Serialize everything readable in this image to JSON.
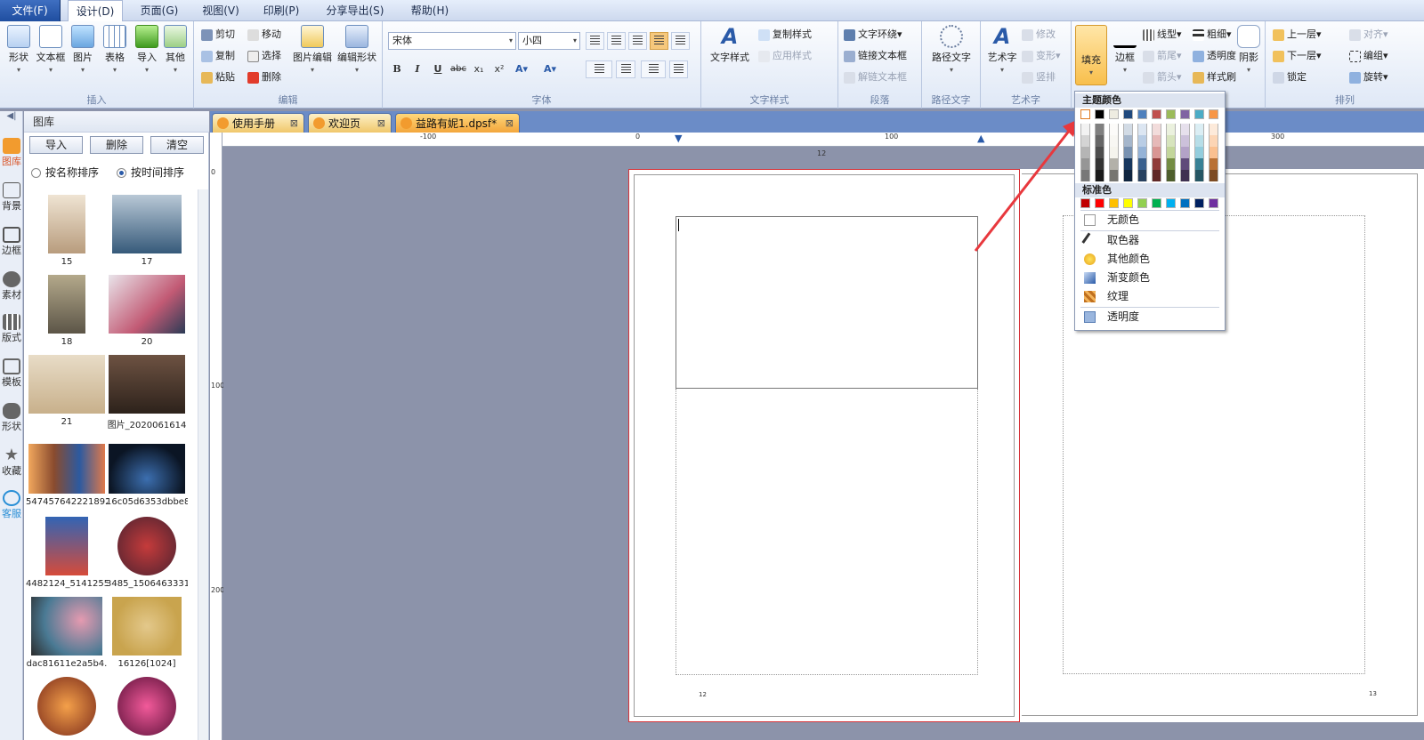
{
  "menubar": {
    "items": [
      "文件(F)",
      "设计(D)",
      "页面(G)",
      "视图(V)",
      "印刷(P)",
      "分享导出(S)",
      "帮助(H)"
    ]
  },
  "ribbon": {
    "insert": {
      "label": "插入",
      "buttons": [
        "形状",
        "文本框",
        "图片",
        "表格",
        "导入",
        "其他"
      ]
    },
    "edit": {
      "label": "编辑",
      "small": [
        "剪切",
        "复制",
        "粘贴",
        "移动",
        "选择",
        "删除"
      ],
      "big": [
        "图片编辑",
        "编辑形状"
      ]
    },
    "font": {
      "label": "字体",
      "font_name": "宋体",
      "font_size": "小四"
    },
    "text_style": {
      "label": "文字样式",
      "big": "文字样式",
      "small": [
        "复制样式",
        "应用样式"
      ]
    },
    "paragraph": {
      "label": "段落",
      "small": [
        "文字环绕",
        "链接文本框",
        "解链文本框"
      ]
    },
    "path_text": {
      "label": "路径文字",
      "big": "路径文字"
    },
    "art_text": {
      "label": "艺术字",
      "big": "艺术字",
      "small": [
        "修改",
        "变形",
        "竖排"
      ]
    },
    "shape_style": {
      "fill": "填充",
      "border": "边框",
      "small": [
        "线型",
        "箭尾",
        "箭头",
        "粗细",
        "透明度",
        "样式刷"
      ],
      "shadow": "阴影"
    },
    "arrange": {
      "label": "排列",
      "small": [
        "上一层",
        "下一层",
        "锁定",
        "对齐",
        "编组",
        "旋转"
      ]
    }
  },
  "gallery": {
    "title": "图库",
    "buttons": [
      "导入",
      "删除",
      "清空"
    ],
    "sort_options": [
      "按名称排序",
      "按时间排序"
    ],
    "sort_selected": "按时间排序",
    "items": [
      "15",
      "17",
      "18",
      "20",
      "21",
      "图片_2020061614",
      "547457642221892",
      "16c05d6353dbbe8",
      "4482124_5141255",
      "3485_1506463331",
      "dac81611e2a5b4.",
      "16126[1024]",
      "",
      ""
    ]
  },
  "side_strip": [
    "图库",
    "背景",
    "边框",
    "素材",
    "版式",
    "模板",
    "形状",
    "收藏",
    "客服"
  ],
  "tabs": [
    {
      "label": "使用手册",
      "active": false
    },
    {
      "label": "欢迎页",
      "active": false
    },
    {
      "label": "益路有妮1.dpsf*",
      "active": true
    }
  ],
  "ruler": {
    "h": [
      "-100",
      "0",
      "100",
      "200",
      "300"
    ],
    "v": [
      "0",
      "100",
      "200"
    ],
    "page_marker": "12"
  },
  "pages": {
    "left_number": "12",
    "right_number": "13"
  },
  "fill_menu": {
    "theme_header": "主题颜色",
    "standard_header": "标准色",
    "theme_top": [
      "#ffffff",
      "#000000",
      "#eeece1",
      "#1f497d",
      "#4f81bd",
      "#c0504d",
      "#9bbb59",
      "#8064a2",
      "#4bacc6",
      "#f79646"
    ],
    "standard": [
      "#c00000",
      "#ff0000",
      "#ffc000",
      "#ffff00",
      "#92d050",
      "#00b050",
      "#00b0f0",
      "#0070c0",
      "#002060",
      "#7030a0"
    ],
    "items": [
      "无颜色",
      "取色器",
      "其他颜色",
      "渐变颜色",
      "纹理",
      "透明度"
    ]
  },
  "watermark": {
    "brand": "Bai du 经验",
    "url": "jingyan.baidu.com"
  }
}
